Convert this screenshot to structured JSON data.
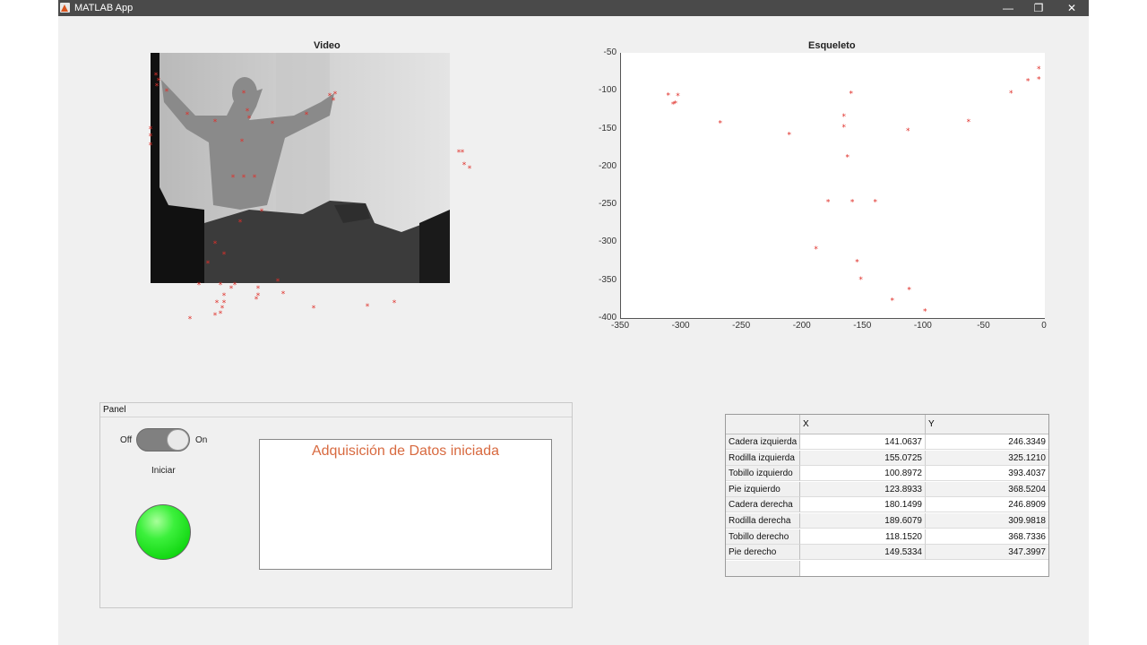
{
  "window": {
    "title": "MATLAB App",
    "minimize_glyph": "—",
    "restore_glyph": "❐",
    "close_glyph": "✕"
  },
  "video_axes": {
    "title": "Video",
    "marker_color": "#e0302a"
  },
  "skeleton_axes": {
    "title": "Esqueleto",
    "marker_color": "#e0302a"
  },
  "chart_data": {
    "type": "scatter",
    "title": "Esqueleto",
    "xlim": [
      -350,
      0
    ],
    "ylim": [
      -400,
      -50
    ],
    "xticks": [
      "-350",
      "-300",
      "-250",
      "-200",
      "-150",
      "-100",
      "-50",
      "0"
    ],
    "yticks": [
      "-50",
      "-100",
      "-150",
      "-200",
      "-250",
      "-300",
      "-350",
      "-400"
    ],
    "marker": "*",
    "color": "#e0302a",
    "grid": false,
    "points": [
      [
        -311,
        -106
      ],
      [
        -303,
        -107
      ],
      [
        -307,
        -118
      ],
      [
        -305,
        -117
      ],
      [
        -268,
        -143
      ],
      [
        -211,
        -158
      ],
      [
        -160,
        -104
      ],
      [
        -166,
        -134
      ],
      [
        -166,
        -148
      ],
      [
        -163,
        -188
      ],
      [
        -179,
        -247
      ],
      [
        -159,
        -247
      ],
      [
        -140,
        -247
      ],
      [
        -189,
        -309
      ],
      [
        -155,
        -326
      ],
      [
        -152,
        -349
      ],
      [
        -126,
        -377
      ],
      [
        -112,
        -363
      ],
      [
        -99,
        -391
      ],
      [
        -113,
        -153
      ],
      [
        -63,
        -141
      ],
      [
        -28,
        -103
      ],
      [
        -14,
        -87
      ],
      [
        -5,
        -71
      ],
      [
        -5,
        -85
      ]
    ]
  },
  "panel": {
    "title": "Panel",
    "switch_off": "Off",
    "switch_on": "On",
    "switch_label": "Iniciar",
    "lamp_color": "#1be01b",
    "message": "Adquisición de Datos iniciada"
  },
  "table": {
    "col_x": "X",
    "col_y": "Y",
    "rows": [
      {
        "name": "Cadera izquierda",
        "x": "141.0637",
        "y": "246.3349"
      },
      {
        "name": "Rodilla izquierda",
        "x": "155.0725",
        "y": "325.1210"
      },
      {
        "name": "Tobillo izquierdo",
        "x": "100.8972",
        "y": "393.4037"
      },
      {
        "name": "Pie izquierdo",
        "x": "123.8933",
        "y": "368.5204"
      },
      {
        "name": "Cadera derecha",
        "x": "180.1499",
        "y": "246.8909"
      },
      {
        "name": "Rodilla derecha",
        "x": "189.6079",
        "y": "309.9818"
      },
      {
        "name": "Tobillo derecho",
        "x": "118.1520",
        "y": "368.7336"
      },
      {
        "name": "Pie derecho",
        "x": "149.5334",
        "y": "347.3997"
      }
    ]
  }
}
